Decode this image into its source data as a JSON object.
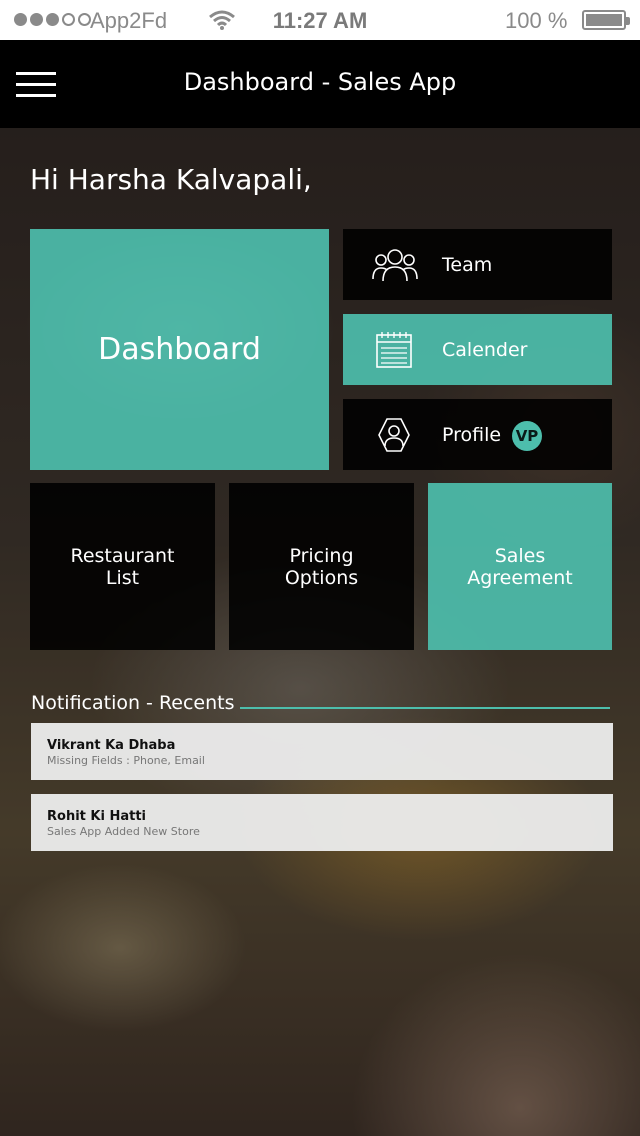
{
  "status_bar": {
    "carrier": "App2Fd",
    "time": "11:27 AM",
    "battery": "100 %"
  },
  "navbar": {
    "title": "Dashboard - Sales App"
  },
  "greeting": "Hi Harsha Kalvapali,",
  "tiles": {
    "dashboard": "Dashboard",
    "team": "Team",
    "calender": "Calender",
    "profile": "Profile",
    "profile_badge": "VP",
    "restaurant_list": [
      "Restaurant",
      "List"
    ],
    "pricing_options": [
      "Pricing",
      "Options"
    ],
    "sales_agreement": [
      "Sales",
      "Agreement"
    ]
  },
  "notifications": {
    "header": "Notification - Recents",
    "items": [
      {
        "title": "Vikrant Ka Dhaba",
        "subtitle": "Missing Fields : Phone, Email"
      },
      {
        "title": "Rohit Ki Hatti",
        "subtitle": "Sales App Added New Store"
      }
    ]
  },
  "colors": {
    "accent": "#4dbeac",
    "tile_dark": "#000000"
  },
  "icons": [
    "hamburger-menu-icon",
    "team-icon",
    "calendar-icon",
    "profile-icon",
    "wifi-icon",
    "battery-icon"
  ]
}
